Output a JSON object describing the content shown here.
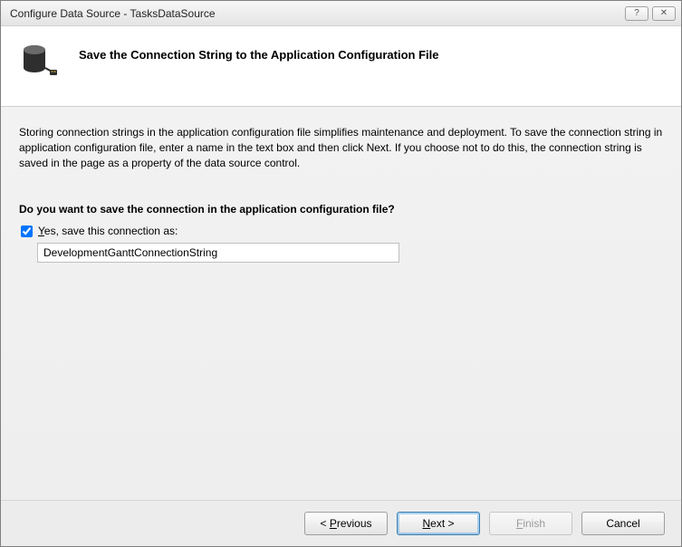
{
  "titlebar": {
    "title": "Configure Data Source - TasksDataSource",
    "help_glyph": "?",
    "close_glyph": "✕"
  },
  "header": {
    "title": "Save the Connection String to the Application Configuration File"
  },
  "body": {
    "instruction": "Storing connection strings in the application configuration file simplifies maintenance and deployment. To save the connection string in application configuration file, enter a name in the text box and then click Next. If you choose not to do this, the connection string is saved in the page as a property of the data source control.",
    "question": "Do you want to save the connection in the application configuration file?",
    "checkbox_mnemonic": "Y",
    "checkbox_label_rest": "es, save this connection as:",
    "input_value": "DevelopmentGanttConnectionString"
  },
  "buttons": {
    "previous_pre": "< ",
    "previous_m": "P",
    "previous_post": "revious",
    "next_m": "N",
    "next_post": "ext >",
    "finish_pre": "",
    "finish_m": "F",
    "finish_post": "inish",
    "cancel": "Cancel"
  }
}
